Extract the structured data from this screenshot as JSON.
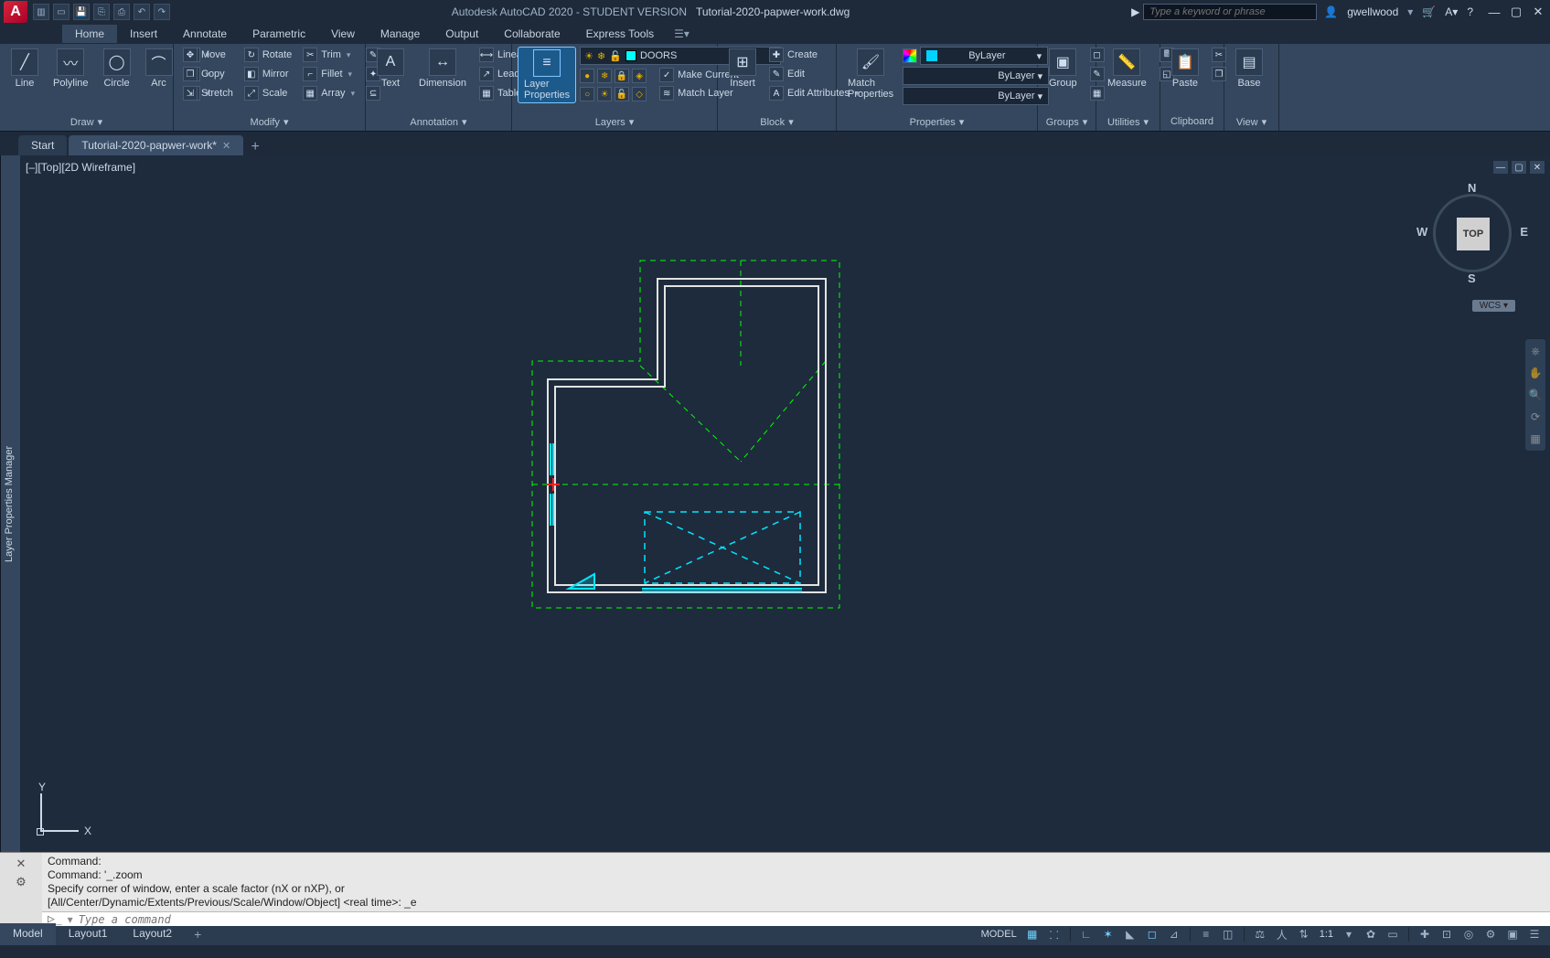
{
  "title": {
    "app": "Autodesk AutoCAD 2020 - STUDENT VERSION",
    "file": "Tutorial-2020-papwer-work.dwg"
  },
  "search": {
    "placeholder": "Type a keyword or phrase"
  },
  "user": "gwellwood",
  "menu": {
    "items": [
      "Home",
      "Insert",
      "Annotate",
      "Parametric",
      "View",
      "Manage",
      "Output",
      "Collaborate",
      "Express Tools"
    ],
    "active": "Home"
  },
  "ribbon": {
    "draw": {
      "title": "Draw",
      "line": "Line",
      "polyline": "Polyline",
      "circle": "Circle",
      "arc": "Arc"
    },
    "modify": {
      "title": "Modify",
      "move": "Move",
      "copy": "Copy",
      "stretch": "Stretch",
      "rotate": "Rotate",
      "mirror": "Mirror",
      "scale": "Scale",
      "trim": "Trim",
      "fillet": "Fillet",
      "array": "Array"
    },
    "annotation": {
      "title": "Annotation",
      "text": "Text",
      "dimension": "Dimension",
      "linear": "Linear",
      "leader": "Leader",
      "table": "Table"
    },
    "layers": {
      "title": "Layers",
      "properties": "Layer\nProperties",
      "current": "DOORS",
      "make_current": "Make Current",
      "match": "Match Layer"
    },
    "block": {
      "title": "Block",
      "insert": "Insert",
      "create": "Create",
      "edit": "Edit",
      "edit_attr": "Edit Attributes"
    },
    "properties": {
      "title": "Properties",
      "match": "Match\nProperties",
      "bylayer": "ByLayer"
    },
    "groups": {
      "title": "Groups",
      "group": "Group"
    },
    "utilities": {
      "title": "Utilities",
      "measure": "Measure"
    },
    "clipboard": {
      "title": "Clipboard",
      "paste": "Paste"
    },
    "view": {
      "title": "View",
      "base": "Base"
    }
  },
  "doctabs": {
    "start": "Start",
    "current": "Tutorial-2020-papwer-work*"
  },
  "viewport": {
    "label": "[–][Top][2D Wireframe]"
  },
  "viewcube": {
    "n": "N",
    "s": "S",
    "e": "E",
    "w": "W",
    "top": "TOP",
    "wcs": "WCS"
  },
  "ucs": {
    "x": "X",
    "y": "Y"
  },
  "side_panel": "Layer Properties Manager",
  "cmd": {
    "line1": "Command:",
    "line2": "Command: '_.zoom",
    "line3": "Specify corner of window, enter a scale factor (nX or nXP), or",
    "line4": "[All/Center/Dynamic/Extents/Previous/Scale/Window/Object] <real time>: _e",
    "placeholder": "Type a command"
  },
  "status": {
    "model": "Model",
    "layout1": "Layout1",
    "layout2": "Layout2",
    "mode": "MODEL",
    "scale": "1:1"
  }
}
